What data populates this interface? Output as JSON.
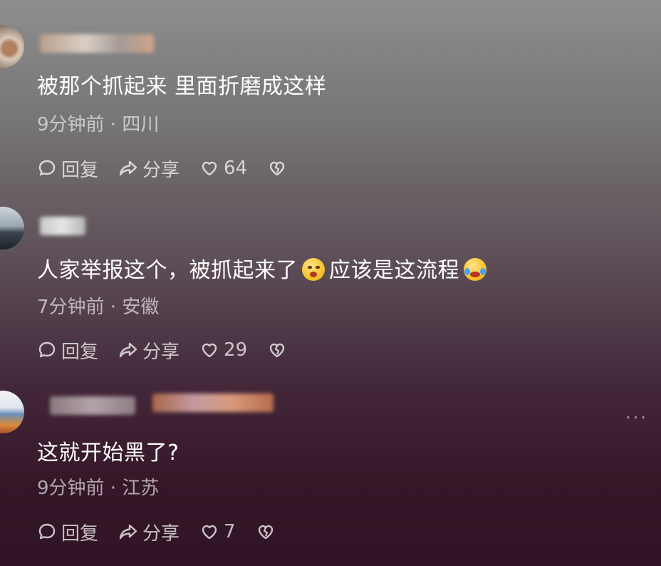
{
  "comments": [
    {
      "text": "被那个抓起来 里面折磨成这样",
      "meta": "9分钟前 · 四川",
      "reply_label": "回复",
      "share_label": "分享",
      "likes": "64"
    },
    {
      "text_part1": "人家举报这个，被抓起来了",
      "emoji1": "kissing-face-emoji",
      "text_part2": "应该是这流程",
      "emoji2": "rolling-laughing-emoji",
      "meta": "7分钟前 · 安徽",
      "reply_label": "回复",
      "share_label": "分享",
      "likes": "29"
    },
    {
      "text": "这就开始黑了?",
      "meta": "9分钟前 · 江苏",
      "reply_label": "回复",
      "share_label": "分享",
      "likes": "7",
      "more_label": "···"
    }
  ],
  "icons": {
    "reply": "comment-bubble-icon",
    "share": "share-arrow-icon",
    "like": "heart-outline-icon",
    "dislike": "broken-heart-icon",
    "more": "more-dots-icon"
  },
  "colors": {
    "text": "#ffffff",
    "meta": "#c8c4c7",
    "background_top": "#8e8e8e",
    "background_bottom": "#301425"
  }
}
